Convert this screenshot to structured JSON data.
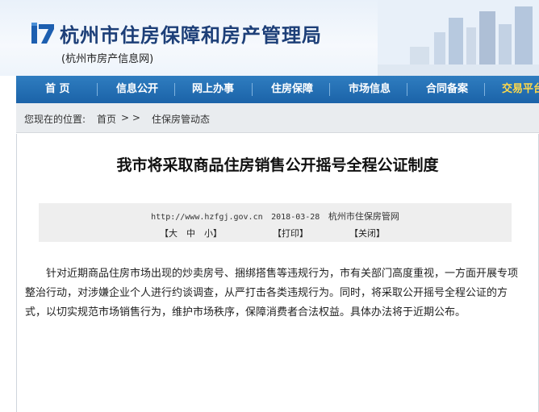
{
  "header": {
    "title": "杭州市住房保障和房产管理局",
    "subtitle": "(杭州市房产信息网)"
  },
  "nav": {
    "items": [
      {
        "label": "首 页"
      },
      {
        "label": "信息公开"
      },
      {
        "label": "网上办事"
      },
      {
        "label": "住房保障"
      },
      {
        "label": "市场信息"
      },
      {
        "label": "合同备案"
      },
      {
        "label": "交易平台"
      }
    ]
  },
  "breadcrumb": {
    "prefix": "您现在的位置:",
    "home": "首页",
    "separator": ">  >",
    "current": "住保房管动态"
  },
  "article": {
    "title": "我市将采取商品住房销售公开摇号全程公证制度",
    "url": "http://www.hzfgj.gov.cn",
    "date": "2018-03-28",
    "source": "杭州市住保房管网",
    "font_label": "【大　中　小】",
    "print_label": "【打印】",
    "close_label": "【关闭】",
    "body": "针对近期商品住房市场出现的炒卖房号、捆绑搭售等违规行为，市有关部门高度重视，一方面开展专项整治行动，对涉嫌企业个人进行约谈调查，从严打击各类违规行为。同时，将采取公开摇号全程公证的方式，以切实规范市场销售行为，维护市场秩序，保障消费者合法权益。具体办法将于近期公布。"
  },
  "colors": {
    "nav_bg": "#1b63a8",
    "nav_highlight": "#ffd94a",
    "title_blue": "#1d3f78"
  }
}
